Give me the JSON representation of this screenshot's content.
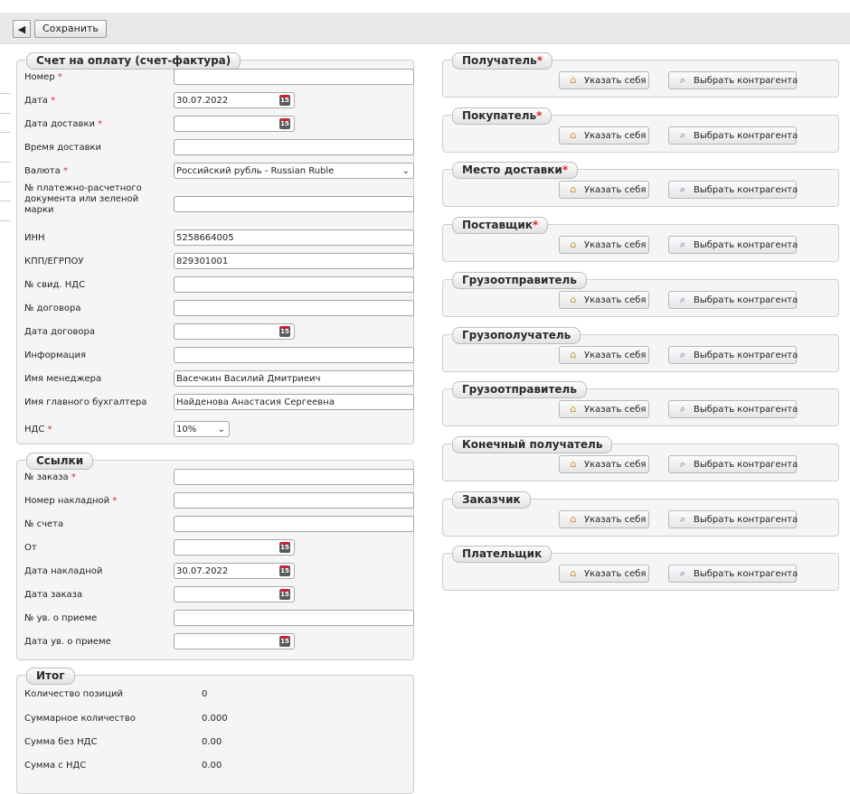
{
  "toolbar": {
    "back_icon": "chevron-left-icon",
    "save_label": "Сохранить"
  },
  "invoice": {
    "title": "Счет на оплату (счет-фактура)",
    "fields": [
      {
        "label": "Номер",
        "required": true,
        "value": "",
        "type": "text"
      },
      {
        "label": "Дата",
        "required": true,
        "value": "30.07.2022",
        "type": "date"
      },
      {
        "label": "Дата доставки",
        "required": true,
        "value": "",
        "type": "date"
      },
      {
        "label": "Время доставки",
        "required": false,
        "value": "",
        "type": "text"
      },
      {
        "label": "Валюта",
        "required": true,
        "value": "Российский рубль - Russian Ruble",
        "type": "select"
      },
      {
        "label": "№ платежно-расчетного документа или зеленой марки",
        "required": false,
        "value": "",
        "type": "text"
      },
      {
        "label": "ИНН",
        "required": false,
        "value": "5258664005",
        "type": "text"
      },
      {
        "label": "КПП/ЕГРПОУ",
        "required": false,
        "value": "829301001",
        "type": "text"
      },
      {
        "label": "№ свид. НДС",
        "required": false,
        "value": "",
        "type": "text"
      },
      {
        "label": "№ договора",
        "required": false,
        "value": "",
        "type": "text"
      },
      {
        "label": "Дата договора",
        "required": false,
        "value": "",
        "type": "date"
      },
      {
        "label": "Информация",
        "required": false,
        "value": "",
        "type": "text"
      },
      {
        "label": "Имя менеджера",
        "required": false,
        "value": "Васечкин Василий Дмитриеич",
        "type": "text"
      },
      {
        "label": "Имя главного бухгалтера",
        "required": false,
        "value": "Найденова Анастасия Сергеевна",
        "type": "text"
      },
      {
        "label": "НДС",
        "required": true,
        "value": "10%",
        "type": "select-small"
      }
    ]
  },
  "links": {
    "title": "Ссылки",
    "fields": [
      {
        "label": "№ заказа",
        "required": true,
        "value": "",
        "type": "text"
      },
      {
        "label": "Номер накладной",
        "required": true,
        "value": "",
        "type": "text"
      },
      {
        "label": "№ счета",
        "required": false,
        "value": "",
        "type": "text"
      },
      {
        "label": "От",
        "required": false,
        "value": "",
        "type": "date"
      },
      {
        "label": "Дата накладной",
        "required": false,
        "value": "30.07.2022",
        "type": "date"
      },
      {
        "label": "Дата заказа",
        "required": false,
        "value": "",
        "type": "date"
      },
      {
        "label": "№ ув. о приеме",
        "required": false,
        "value": "",
        "type": "text"
      },
      {
        "label": "Дата ув. о приеме",
        "required": false,
        "value": "",
        "type": "date"
      }
    ]
  },
  "totals": {
    "title": "Итог",
    "rows": [
      {
        "label": "Количество позиций",
        "value": "0"
      },
      {
        "label": "Суммарное количество",
        "value": "0.000"
      },
      {
        "label": "Сумма без НДС",
        "value": "0.00"
      },
      {
        "label": "Сумма с НДС",
        "value": "0.00"
      }
    ]
  },
  "parties": {
    "self_label": "Указать себя",
    "choose_label": "Выбрать контрагента",
    "items": [
      {
        "title": "Получатель",
        "required": true
      },
      {
        "title": "Покупатель",
        "required": true
      },
      {
        "title": "Место доставки",
        "required": true
      },
      {
        "title": "Поставщик",
        "required": true
      },
      {
        "title": "Грузоотправитель",
        "required": false
      },
      {
        "title": "Грузополучатель",
        "required": false
      },
      {
        "title": "Грузоотправитель",
        "required": false
      },
      {
        "title": "Конечный получатель",
        "required": false
      },
      {
        "title": "Заказчик",
        "required": false
      },
      {
        "title": "Плательщик",
        "required": false
      }
    ]
  },
  "colors": {
    "required": "#d9262c",
    "panel": "#f5f5f5",
    "toolbar": "#e9e9e9"
  }
}
